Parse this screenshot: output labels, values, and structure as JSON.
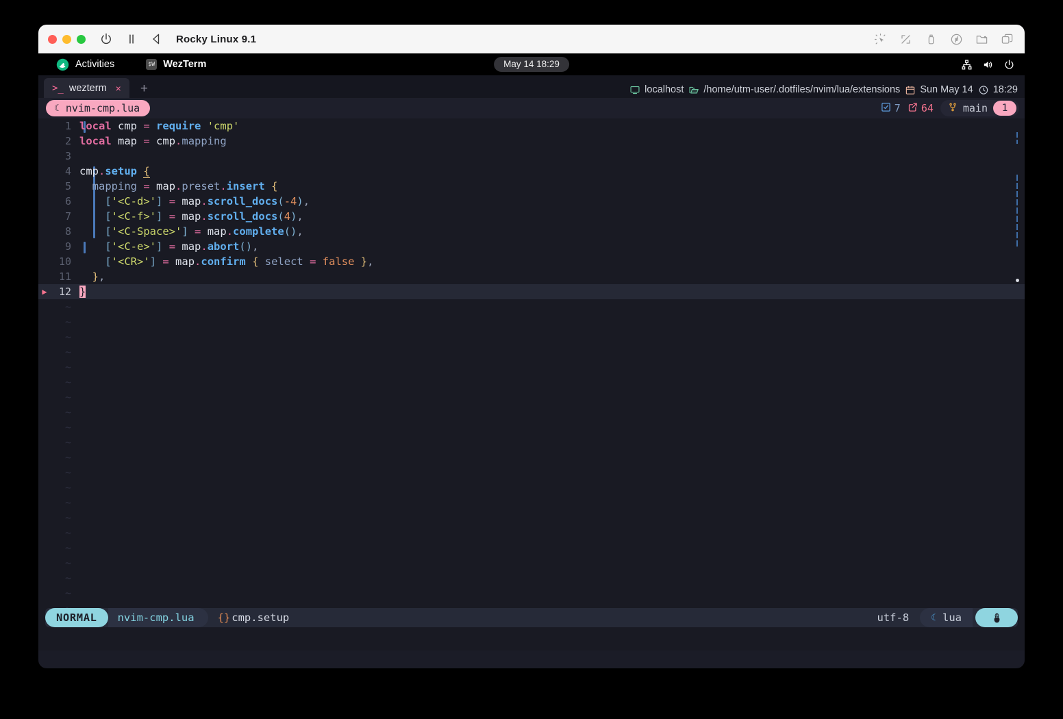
{
  "window": {
    "title": "Rocky Linux 9.1",
    "titlebar_icons": [
      "power-icon",
      "pause-icon",
      "back-icon"
    ],
    "titlebar_right_icons": [
      "capture-icon",
      "resize-icon",
      "usb-icon",
      "disc-icon",
      "shared-folder-icon",
      "windows-icon"
    ]
  },
  "gnome": {
    "activities": "Activities",
    "app_name": "WezTerm",
    "app_icon_text": "$W",
    "clock": "May 14  18:29",
    "tray_icons": [
      "network-icon",
      "volume-icon",
      "power-icon"
    ]
  },
  "wezterm": {
    "tab": {
      "prompt": ">_",
      "label": "wezterm",
      "close": "×"
    },
    "new_tab": "+",
    "status": [
      {
        "icon": "monitor-icon",
        "text": "localhost"
      },
      {
        "icon": "folder-icon",
        "text": "/home/utm-user/.dotfiles/nvim/lua/extensions"
      },
      {
        "icon": "calendar-icon",
        "text": "Sun May 14"
      },
      {
        "icon": "clock-icon",
        "text": "18:29"
      }
    ]
  },
  "bufferline": {
    "buffer": {
      "icon": "lua-moon-icon",
      "name": "nvim-cmp.lua"
    },
    "diagnostics_ok": "7",
    "modified_count": "64",
    "branch": "main",
    "badge": "1"
  },
  "editor": {
    "lines": [
      {
        "num": "1",
        "text": "local cmp = require 'cmp'"
      },
      {
        "num": "2",
        "text": "local map = cmp.mapping"
      },
      {
        "num": "3",
        "text": ""
      },
      {
        "num": "4",
        "text": "cmp.setup {"
      },
      {
        "num": "5",
        "text": "  mapping = map.preset.insert {"
      },
      {
        "num": "6",
        "text": "    ['<C-d>'] = map.scroll_docs(-4),"
      },
      {
        "num": "7",
        "text": "    ['<C-f>'] = map.scroll_docs(4),"
      },
      {
        "num": "8",
        "text": "    ['<C-Space>'] = map.complete(),"
      },
      {
        "num": "9",
        "text": "    ['<C-e>'] = map.abort(),"
      },
      {
        "num": "10",
        "text": "    ['<CR>'] = map.confirm { select = false },"
      },
      {
        "num": "11",
        "text": "  },"
      },
      {
        "num": "12",
        "text": "}"
      }
    ],
    "empty_marker": "~",
    "sign_marker": "▶"
  },
  "statusline": {
    "mode": "NORMAL",
    "file": "nvim-cmp.lua",
    "context_icon": "{}",
    "context": "cmp.setup",
    "encoding": "utf-8",
    "filetype": "lua",
    "os_icon": "linux-penguin-icon"
  },
  "colors": {
    "accent_pink": "#f9a8c0",
    "accent_cyan": "#8fd5e0",
    "editor_bg": "#191a23",
    "titlebar_bg": "#f6f6f6"
  }
}
